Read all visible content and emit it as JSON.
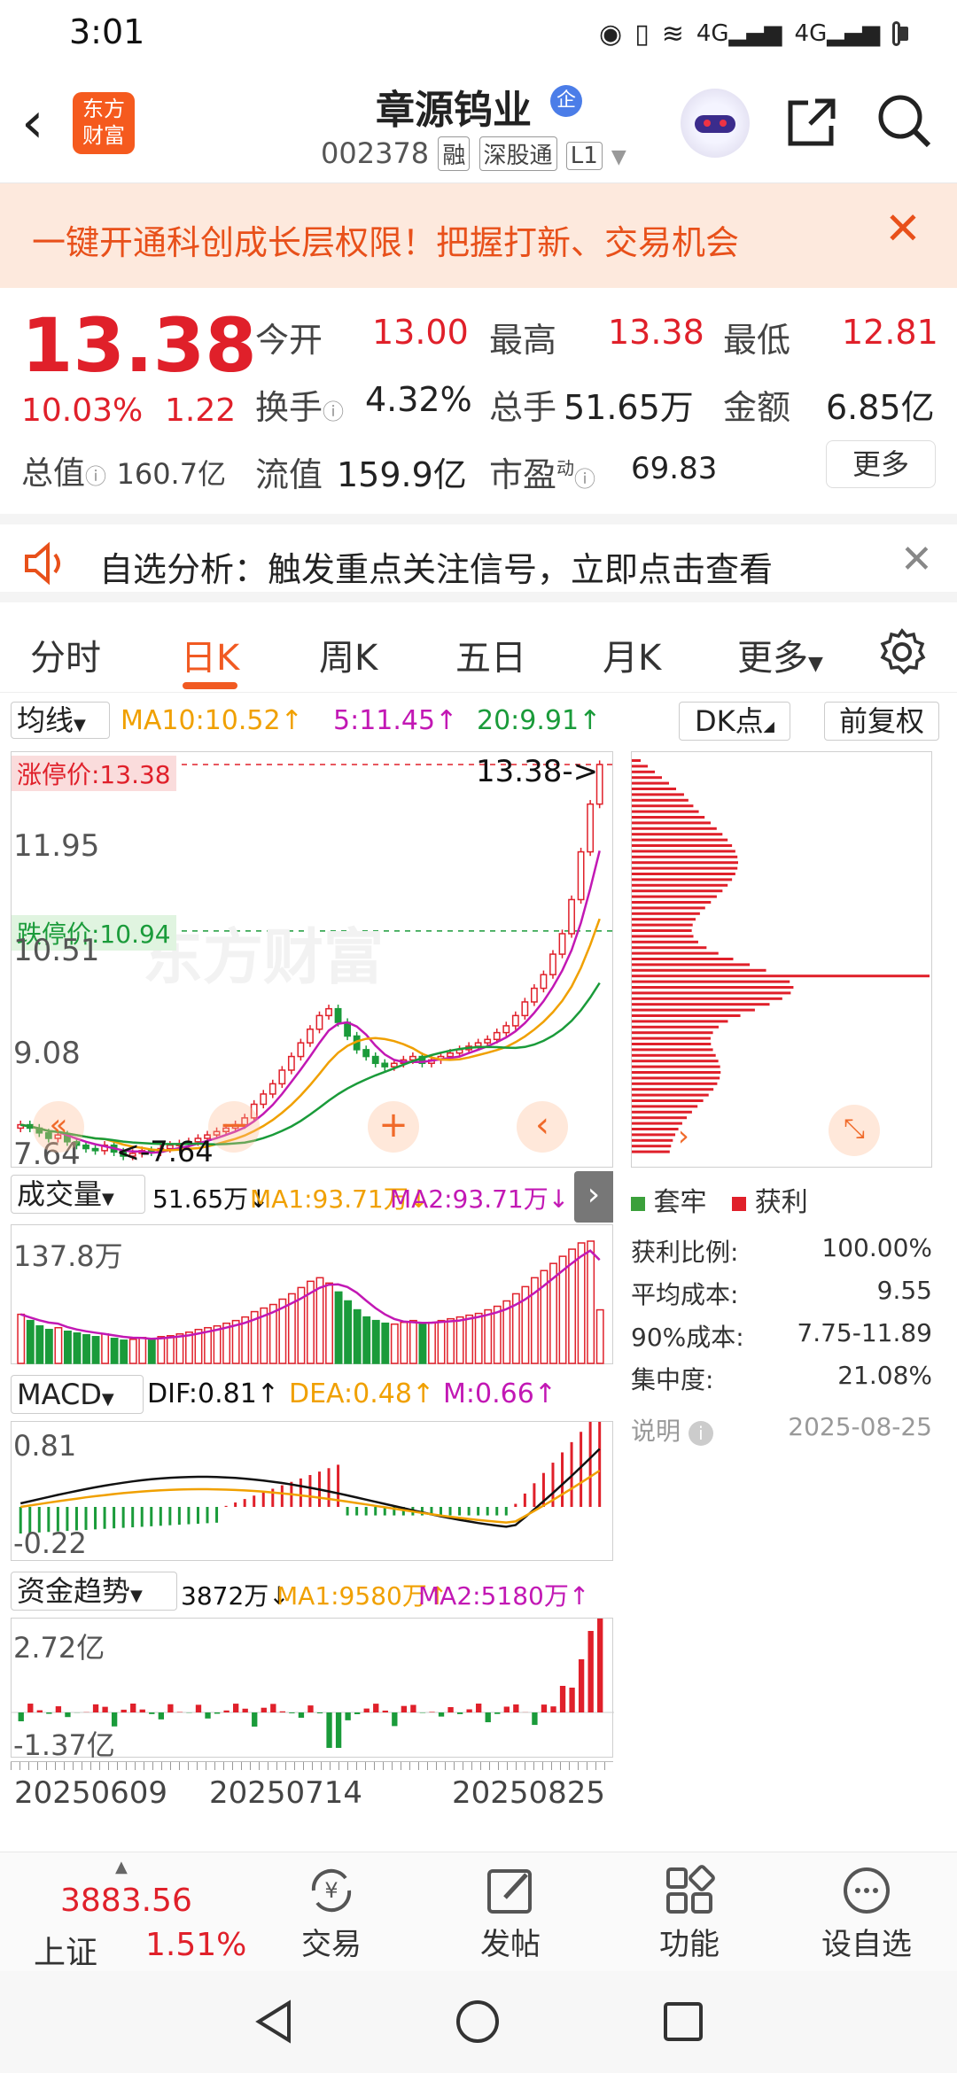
{
  "status": {
    "time": "3:01"
  },
  "header": {
    "logo_line1": "东方",
    "logo_line2": "财富",
    "stock_name": "章源钨业",
    "badge": "企",
    "stock_code": "002378",
    "tag_margin": "融",
    "tag_connect": "深股通",
    "tag_level": "L1"
  },
  "banner": {
    "text": "一键开通科创成长层权限！把握打新、交易机会"
  },
  "quote": {
    "price": "13.38",
    "change_pct": "10.03%",
    "change": "1.22",
    "open_label": "今开",
    "open": "13.00",
    "high_label": "最高",
    "high": "13.38",
    "low_label": "最低",
    "low": "12.81",
    "turnover_label": "换手",
    "turnover": "4.32%",
    "volume_label": "总手",
    "volume": "51.65万",
    "amount_label": "金额",
    "amount": "6.85亿",
    "mktcap_label": "总值",
    "mktcap": "160.7亿",
    "float_label": "流值",
    "float": "159.9亿",
    "pe_label": "市盈",
    "pe_sup": "动",
    "pe": "69.83",
    "more": "更多"
  },
  "notice": {
    "text": "自选分析：触发重点关注信号，立即点击查看"
  },
  "tabs": [
    "分时",
    "日K",
    "周K",
    "五日",
    "月K",
    "更多"
  ],
  "active_tab": 1,
  "kline": {
    "ma_select": "均线",
    "ma10": "MA10:10.52↑",
    "ma5": "5:11.45↑",
    "ma20": "20:9.91↑",
    "dk_btn": "DK点",
    "adjust_btn": "前复权",
    "limit_up": "涨停价:13.38",
    "limit_down": "跌停价:10.94",
    "last_price": "13.38->",
    "low_mark": "<-7.64",
    "y_labels": [
      "11.95",
      "10.51",
      "9.08",
      "7.64"
    ],
    "watermark": "东方财富"
  },
  "chart_data": [
    {
      "type": "candlestick",
      "title": "日K",
      "y_range": [
        7.64,
        13.38
      ],
      "x_dates": [
        "20250609",
        "20250714",
        "20250825"
      ],
      "close": [
        8.1,
        8.05,
        7.98,
        7.9,
        7.95,
        7.85,
        7.8,
        7.75,
        7.72,
        7.8,
        7.7,
        7.64,
        7.68,
        7.72,
        7.7,
        7.75,
        7.8,
        7.82,
        7.85,
        7.9,
        7.95,
        8.0,
        8.05,
        8.1,
        8.2,
        8.4,
        8.55,
        8.7,
        8.9,
        9.1,
        9.3,
        9.5,
        9.7,
        9.8,
        9.6,
        9.4,
        9.2,
        9.1,
        9.0,
        8.95,
        9.0,
        9.05,
        9.1,
        9.0,
        9.05,
        9.1,
        9.15,
        9.2,
        9.25,
        9.3,
        9.35,
        9.45,
        9.55,
        9.7,
        9.9,
        10.1,
        10.3,
        10.6,
        10.9,
        11.4,
        12.1,
        12.8,
        13.38
      ],
      "ma5": "11.45",
      "ma10": "10.52",
      "ma20": "9.91"
    },
    {
      "type": "bar",
      "title": "成交量",
      "y_max_label": "137.8万",
      "values": [
        55,
        48,
        42,
        38,
        40,
        36,
        34,
        32,
        30,
        33,
        28,
        26,
        27,
        29,
        28,
        30,
        31,
        33,
        35,
        38,
        40,
        42,
        45,
        48,
        52,
        58,
        62,
        66,
        72,
        78,
        85,
        92,
        96,
        90,
        80,
        70,
        60,
        52,
        48,
        45,
        44,
        46,
        48,
        44,
        46,
        48,
        50,
        52,
        54,
        56,
        60,
        64,
        70,
        78,
        86,
        96,
        104,
        112,
        120,
        128,
        135,
        137,
        60
      ]
    },
    {
      "type": "bar",
      "title": "MACD",
      "dif": "0.81",
      "dea": "0.48",
      "m": "0.66",
      "y_labels": [
        "0.81",
        "-0.22"
      ]
    },
    {
      "type": "bar",
      "title": "资金趋势",
      "value": "3872万",
      "ma1": "9580万",
      "ma2": "5180万",
      "y_labels": [
        "2.72亿",
        "-1.37亿"
      ]
    }
  ],
  "volume": {
    "select": "成交量",
    "v": "51.65万↓",
    "ma1": "MA1:93.71万↓",
    "ma2": "MA2:93.71万↓",
    "ymax": "137.8万"
  },
  "macd": {
    "select": "MACD",
    "dif": "DIF:0.81↑",
    "dea": "DEA:0.48↑",
    "m": "M:0.66↑",
    "y_top": "0.81",
    "y_bottom": "-0.22"
  },
  "fund": {
    "select": "资金趋势",
    "v": "3872万↓",
    "ma1": "MA1:9580万↑",
    "ma2": "MA2:5180万↑",
    "y_top": "2.72亿",
    "y_bottom": "-1.37亿"
  },
  "dates": [
    "20250609",
    "20250714",
    "20250825"
  ],
  "chip": {
    "legend_trap": "套牢",
    "legend_profit": "获利",
    "rows": [
      {
        "label": "获利比例:",
        "value": "100.00%"
      },
      {
        "label": "平均成本:",
        "value": "9.55"
      },
      {
        "label": "90%成本:",
        "value": "7.75-11.89"
      },
      {
        "label": "集中度:",
        "value": "21.08%"
      }
    ],
    "explain": "说明",
    "date": "2025-08-25"
  },
  "bottom": {
    "index_value": "3883.56",
    "index_name": "上证",
    "index_pct": "1.51%",
    "items": [
      "交易",
      "发帖",
      "功能",
      "设自选"
    ]
  },
  "colors": {
    "up": "#e0202a",
    "down": "#1a9b3a",
    "accent": "#ff6a00"
  }
}
